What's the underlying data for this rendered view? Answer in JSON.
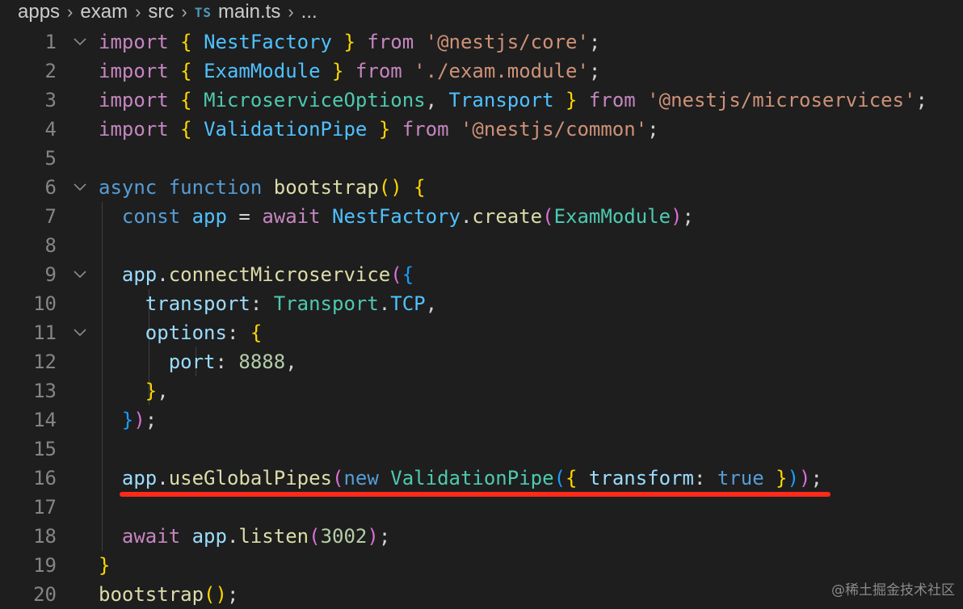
{
  "breadcrumb": {
    "parts": [
      "apps",
      "exam",
      "src"
    ],
    "file_badge": "TS",
    "file_name": "main.ts",
    "more": "..."
  },
  "editor": {
    "lines": [
      {
        "n": "1",
        "fold": true,
        "indent": 0,
        "tokens": [
          [
            "import",
            "kw"
          ],
          [
            " ",
            "p"
          ],
          [
            "{",
            "b1"
          ],
          [
            " ",
            "p"
          ],
          [
            "NestFactory",
            "const"
          ],
          [
            " ",
            "p"
          ],
          [
            "}",
            "b1"
          ],
          [
            " ",
            "p"
          ],
          [
            "from",
            "kw"
          ],
          [
            " ",
            "p"
          ],
          [
            "'@nestjs/core'",
            "str"
          ],
          [
            ";",
            "p"
          ]
        ]
      },
      {
        "n": "2",
        "fold": false,
        "indent": 0,
        "tokens": [
          [
            "import",
            "kw"
          ],
          [
            " ",
            "p"
          ],
          [
            "{",
            "b1"
          ],
          [
            " ",
            "p"
          ],
          [
            "ExamModule",
            "const"
          ],
          [
            " ",
            "p"
          ],
          [
            "}",
            "b1"
          ],
          [
            " ",
            "p"
          ],
          [
            "from",
            "kw"
          ],
          [
            " ",
            "p"
          ],
          [
            "'./exam.module'",
            "str"
          ],
          [
            ";",
            "p"
          ]
        ]
      },
      {
        "n": "3",
        "fold": false,
        "indent": 0,
        "tokens": [
          [
            "import",
            "kw"
          ],
          [
            " ",
            "p"
          ],
          [
            "{",
            "b1"
          ],
          [
            " ",
            "p"
          ],
          [
            "MicroserviceOptions",
            "type"
          ],
          [
            ", ",
            "p"
          ],
          [
            "Transport",
            "const"
          ],
          [
            " ",
            "p"
          ],
          [
            "}",
            "b1"
          ],
          [
            " ",
            "p"
          ],
          [
            "from",
            "kw"
          ],
          [
            " ",
            "p"
          ],
          [
            "'@nestjs/microservices'",
            "str"
          ],
          [
            ";",
            "p"
          ]
        ]
      },
      {
        "n": "4",
        "fold": false,
        "indent": 0,
        "tokens": [
          [
            "import",
            "kw"
          ],
          [
            " ",
            "p"
          ],
          [
            "{",
            "b1"
          ],
          [
            " ",
            "p"
          ],
          [
            "ValidationPipe",
            "const"
          ],
          [
            " ",
            "p"
          ],
          [
            "}",
            "b1"
          ],
          [
            " ",
            "p"
          ],
          [
            "from",
            "kw"
          ],
          [
            " ",
            "p"
          ],
          [
            "'@nestjs/common'",
            "str"
          ],
          [
            ";",
            "p"
          ]
        ]
      },
      {
        "n": "5",
        "fold": false,
        "indent": 0,
        "tokens": []
      },
      {
        "n": "6",
        "fold": true,
        "indent": 0,
        "tokens": [
          [
            "async",
            "kw2"
          ],
          [
            " ",
            "p"
          ],
          [
            "function",
            "kw2"
          ],
          [
            " ",
            "p"
          ],
          [
            "bootstrap",
            "fn"
          ],
          [
            "()",
            "b1"
          ],
          [
            " ",
            "p"
          ],
          [
            "{",
            "b1"
          ]
        ]
      },
      {
        "n": "7",
        "fold": false,
        "indent": 1,
        "tokens": [
          [
            "const",
            "kw2"
          ],
          [
            " ",
            "p"
          ],
          [
            "app",
            "const"
          ],
          [
            " = ",
            "p"
          ],
          [
            "await",
            "kw"
          ],
          [
            " ",
            "p"
          ],
          [
            "NestFactory",
            "const"
          ],
          [
            ".",
            "p"
          ],
          [
            "create",
            "fn"
          ],
          [
            "(",
            "b2"
          ],
          [
            "ExamModule",
            "type"
          ],
          [
            ")",
            "b2"
          ],
          [
            ";",
            "p"
          ]
        ]
      },
      {
        "n": "8",
        "fold": false,
        "indent": 1,
        "tokens": []
      },
      {
        "n": "9",
        "fold": true,
        "indent": 1,
        "tokens": [
          [
            "app",
            "var"
          ],
          [
            ".",
            "p"
          ],
          [
            "connectMicroservice",
            "fn"
          ],
          [
            "(",
            "b2"
          ],
          [
            "{",
            "b3"
          ]
        ]
      },
      {
        "n": "10",
        "fold": false,
        "indent": 2,
        "tokens": [
          [
            "transport",
            "var"
          ],
          [
            ": ",
            "p"
          ],
          [
            "Transport",
            "type"
          ],
          [
            ".",
            "p"
          ],
          [
            "TCP",
            "const"
          ],
          [
            ",",
            "p"
          ]
        ]
      },
      {
        "n": "11",
        "fold": true,
        "indent": 2,
        "tokens": [
          [
            "options",
            "var"
          ],
          [
            ": ",
            "p"
          ],
          [
            "{",
            "b1"
          ]
        ]
      },
      {
        "n": "12",
        "fold": false,
        "indent": 3,
        "tokens": [
          [
            "port",
            "var"
          ],
          [
            ": ",
            "p"
          ],
          [
            "8888",
            "num"
          ],
          [
            ",",
            "p"
          ]
        ]
      },
      {
        "n": "13",
        "fold": false,
        "indent": 2,
        "tokens": [
          [
            "}",
            "b1"
          ],
          [
            ",",
            "p"
          ]
        ]
      },
      {
        "n": "14",
        "fold": false,
        "indent": 1,
        "tokens": [
          [
            "}",
            "b3"
          ],
          [
            ")",
            "b2"
          ],
          [
            ";",
            "p"
          ]
        ]
      },
      {
        "n": "15",
        "fold": false,
        "indent": 1,
        "tokens": []
      },
      {
        "n": "16",
        "fold": false,
        "indent": 1,
        "tokens": [
          [
            "app",
            "var"
          ],
          [
            ".",
            "p"
          ],
          [
            "useGlobalPipes",
            "fn"
          ],
          [
            "(",
            "b2"
          ],
          [
            "new",
            "kw2"
          ],
          [
            " ",
            "p"
          ],
          [
            "ValidationPipe",
            "type"
          ],
          [
            "(",
            "b3"
          ],
          [
            "{",
            "b1"
          ],
          [
            " ",
            "p"
          ],
          [
            "transform",
            "var"
          ],
          [
            ": ",
            "p"
          ],
          [
            "true",
            "kw2"
          ],
          [
            " ",
            "p"
          ],
          [
            "}",
            "b1"
          ],
          [
            ")",
            "b3"
          ],
          [
            ")",
            "b2"
          ],
          [
            ";",
            "p"
          ]
        ]
      },
      {
        "n": "17",
        "fold": false,
        "indent": 1,
        "tokens": []
      },
      {
        "n": "18",
        "fold": false,
        "indent": 1,
        "tokens": [
          [
            "await",
            "kw"
          ],
          [
            " ",
            "p"
          ],
          [
            "app",
            "var"
          ],
          [
            ".",
            "p"
          ],
          [
            "listen",
            "fn"
          ],
          [
            "(",
            "b2"
          ],
          [
            "3002",
            "num"
          ],
          [
            ")",
            "b2"
          ],
          [
            ";",
            "p"
          ]
        ]
      },
      {
        "n": "19",
        "fold": false,
        "indent": 0,
        "tokens": [
          [
            "}",
            "b1"
          ]
        ]
      },
      {
        "n": "20",
        "fold": false,
        "indent": 0,
        "tokens": [
          [
            "bootstrap",
            "fn"
          ],
          [
            "()",
            "b1"
          ],
          [
            ";",
            "p"
          ]
        ]
      }
    ],
    "highlight_line": "16",
    "highlight_color": "#ff2a1a"
  },
  "watermark": "@稀土掘金技术社区",
  "colors": {
    "background": "#1e1e1e",
    "line_number": "#858585",
    "keyword": "#c586c0",
    "storage": "#569cd6",
    "string": "#ce9178",
    "function": "#dcdcaa"
  }
}
